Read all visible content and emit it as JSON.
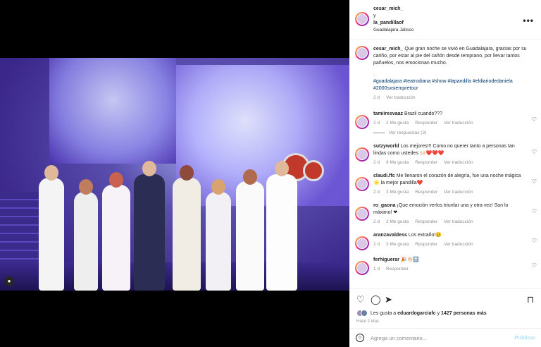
{
  "post": {
    "author1": "cesar_mich_",
    "conjunction": "y",
    "author2": "la_pandillaof",
    "location": "Guadalajara Jalisco",
    "more_icon": "more-horizontal-icon"
  },
  "caption": {
    "username": "cesar_mich_",
    "text": "Que gran noche se vivió en Guadalajara, gracias por su cariño, por estar al pie del cañón desde temprano, por llevar tantos pañuelos, nos emocionan mucho.",
    "dot": ".",
    "hashtags": "#guadalajara #teatrodiana #show #lapandilla #eldiariodedaniela #2000sxsiempretour",
    "time": "2 d",
    "translate": "Ver traducción"
  },
  "comments": [
    {
      "user": "tamiiresvaaz",
      "text": "Brazil cuando???",
      "time": "2 d",
      "likes": "2 Me gusta",
      "reply": "Responder",
      "translate": "Ver traducción",
      "view_replies": "Ver respuestas (3)"
    },
    {
      "user": "sutzyworld",
      "text": "Los mejores!!! Como no querer tanto a personas tan lindas como ustedes 🙌🏻❤️❤️❤️",
      "time": "2 d",
      "likes": "9 Me gusta",
      "reply": "Responder",
      "translate": "Ver traducción"
    },
    {
      "user": "claudi.ffc",
      "text": "Me llenaron el corazón de alegría, fue una noche mágica🌟 la mejor pandilla❤️",
      "time": "2 d",
      "likes": "3 Me gusta",
      "reply": "Responder",
      "translate": "Ver traducción"
    },
    {
      "user": "ro_gaona",
      "text": "¡Que emoción verlos triunfar una y otra vez! Son lo máximo! ❤",
      "time": "2 d",
      "likes": "2 Me gusta",
      "reply": "Responder",
      "translate": "Ver traducción"
    },
    {
      "user": "aranzavaldess",
      "text": "Los extraño!😢",
      "time": "2 d",
      "likes": "3 Me gusta",
      "reply": "Responder",
      "translate": "Ver traducción"
    },
    {
      "user": "ferhiguerar",
      "text": "🎉👏🏻⬆️",
      "time": "1 d",
      "reply": "Responder"
    }
  ],
  "actions": {
    "likes_prefix": "Les gusta a",
    "likes_user": "eduardogarciafc",
    "likes_mid": "y",
    "likes_count": "1427 personas más",
    "date": "Hace 2 días"
  },
  "composer": {
    "placeholder": "Agrega un comentario...",
    "publish": "Publicar"
  },
  "colors": {
    "link": "#00376b",
    "muted": "#8e8e8e",
    "publish_disabled": "#b2dffc"
  }
}
